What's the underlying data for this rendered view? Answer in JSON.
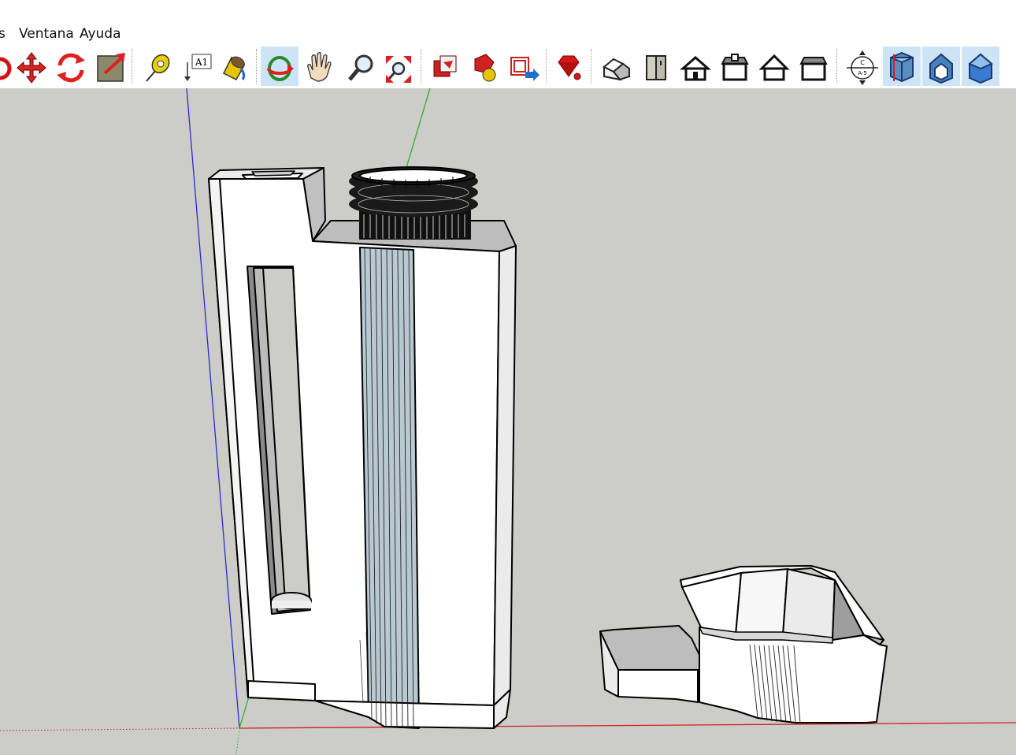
{
  "menu": {
    "items": [
      {
        "label": "s"
      },
      {
        "label": "Ventana"
      },
      {
        "label": "Ayuda"
      }
    ]
  },
  "toolbar": {
    "tools": [
      {
        "name": "orbit-partial"
      },
      {
        "name": "move"
      },
      {
        "name": "rotate"
      },
      {
        "name": "scale"
      },
      {
        "name": "tape-measure"
      },
      {
        "name": "text"
      },
      {
        "name": "paint-bucket"
      },
      {
        "name": "orbit",
        "active": true
      },
      {
        "name": "pan"
      },
      {
        "name": "zoom"
      },
      {
        "name": "zoom-extents"
      },
      {
        "name": "3d-warehouse"
      },
      {
        "name": "share-model"
      },
      {
        "name": "extension-warehouse"
      },
      {
        "name": "ruby-console"
      },
      {
        "name": "iso-view"
      },
      {
        "name": "top-view"
      },
      {
        "name": "front-view"
      },
      {
        "name": "right-view"
      },
      {
        "name": "back-view"
      },
      {
        "name": "left-view"
      },
      {
        "name": "section-plane"
      },
      {
        "name": "xray-section",
        "active": true
      },
      {
        "name": "display-section-cuts",
        "active": true
      },
      {
        "name": "section-fill",
        "active": true
      }
    ],
    "text_tool_label": "A1",
    "section_label_top": "C",
    "section_label_bottom": "A-5"
  },
  "colors": {
    "viewport_bg": "#ccccc8",
    "axis_blue": "#2b2bd0",
    "axis_green": "#2bb02b",
    "axis_red": "#d02020",
    "face_white": "#ffffff",
    "face_shade": "#ebebeb",
    "face_grey": "#bdbdbd",
    "face_blue": "#b9c9d2",
    "toolbar_active": "#cde4f7"
  }
}
